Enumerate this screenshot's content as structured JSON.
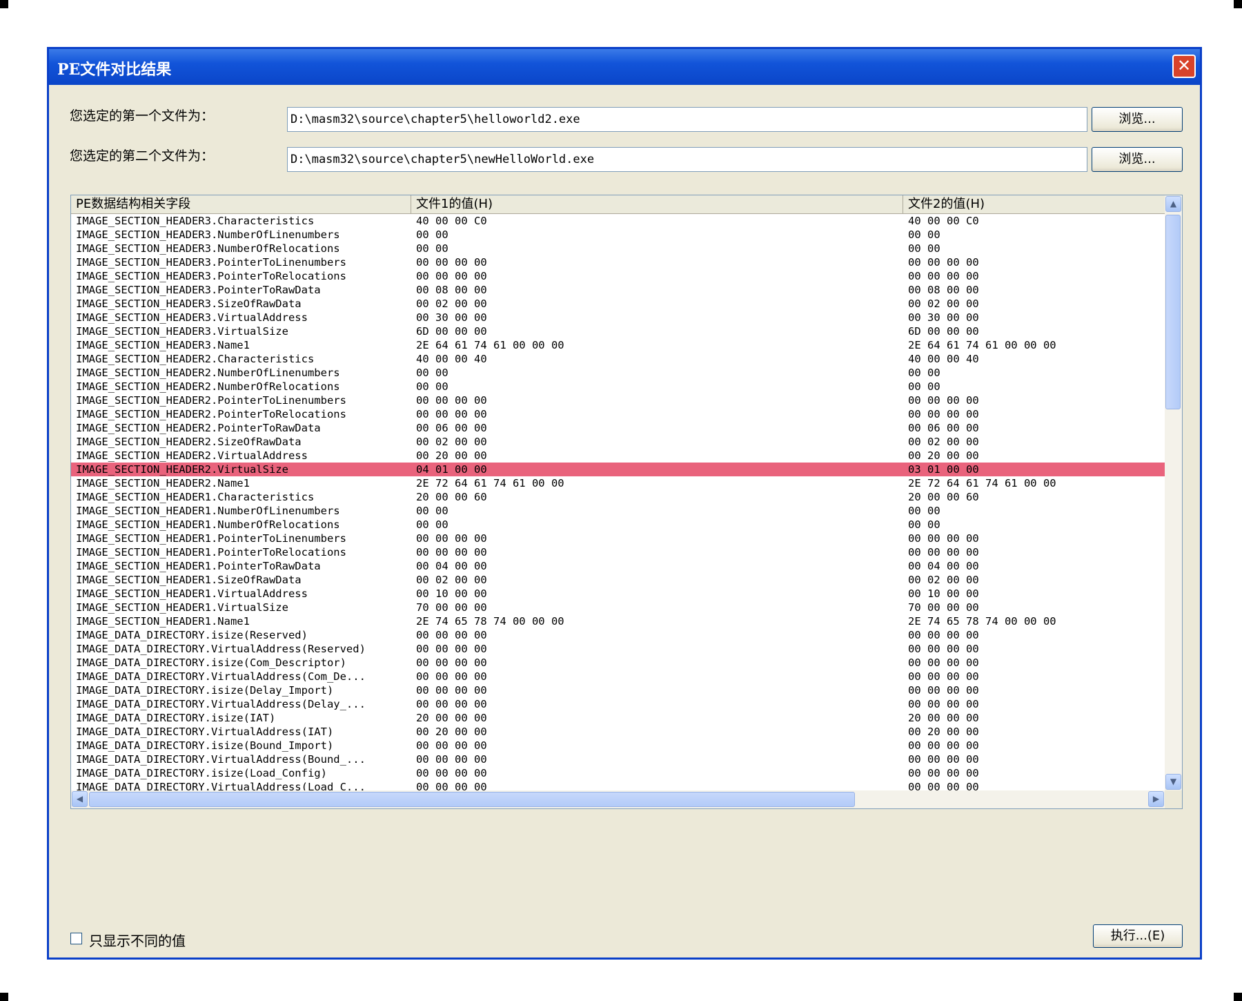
{
  "window": {
    "title": "PE文件对比结果",
    "close_label": "✕"
  },
  "file1": {
    "label": "您选定的第一个文件为：",
    "path": "D:\\masm32\\source\\chapter5\\helloworld2.exe",
    "browse_label": "浏览..."
  },
  "file2": {
    "label": "您选定的第二个文件为：",
    "path": "D:\\masm32\\source\\chapter5\\newHelloWorld.exe",
    "browse_label": "浏览..."
  },
  "table": {
    "columns": [
      "PE数据结构相关字段",
      "文件1的值(H)",
      "文件2的值(H)"
    ],
    "highlight_color": "#e9637c",
    "rows": [
      {
        "field": "IMAGE_SECTION_HEADER3.Characteristics",
        "v1": "40 00 00 C0",
        "v2": "40 00 00 C0"
      },
      {
        "field": "IMAGE_SECTION_HEADER3.NumberOfLinenumbers",
        "v1": "00 00",
        "v2": "00 00"
      },
      {
        "field": "IMAGE_SECTION_HEADER3.NumberOfRelocations",
        "v1": "00 00",
        "v2": "00 00"
      },
      {
        "field": "IMAGE_SECTION_HEADER3.PointerToLinenumbers",
        "v1": "00 00 00 00",
        "v2": "00 00 00 00"
      },
      {
        "field": "IMAGE_SECTION_HEADER3.PointerToRelocations",
        "v1": "00 00 00 00",
        "v2": "00 00 00 00"
      },
      {
        "field": "IMAGE_SECTION_HEADER3.PointerToRawData",
        "v1": "00 08 00 00",
        "v2": "00 08 00 00"
      },
      {
        "field": "IMAGE_SECTION_HEADER3.SizeOfRawData",
        "v1": "00 02 00 00",
        "v2": "00 02 00 00"
      },
      {
        "field": "IMAGE_SECTION_HEADER3.VirtualAddress",
        "v1": "00 30 00 00",
        "v2": "00 30 00 00"
      },
      {
        "field": "IMAGE_SECTION_HEADER3.VirtualSize",
        "v1": "6D 00 00 00",
        "v2": "6D 00 00 00"
      },
      {
        "field": "IMAGE_SECTION_HEADER3.Name1",
        "v1": "2E 64 61 74 61 00 00 00",
        "v2": "2E 64 61 74 61 00 00 00"
      },
      {
        "field": "IMAGE_SECTION_HEADER2.Characteristics",
        "v1": "40 00 00 40",
        "v2": "40 00 00 40"
      },
      {
        "field": "IMAGE_SECTION_HEADER2.NumberOfLinenumbers",
        "v1": "00 00",
        "v2": "00 00"
      },
      {
        "field": "IMAGE_SECTION_HEADER2.NumberOfRelocations",
        "v1": "00 00",
        "v2": "00 00"
      },
      {
        "field": "IMAGE_SECTION_HEADER2.PointerToLinenumbers",
        "v1": "00 00 00 00",
        "v2": "00 00 00 00"
      },
      {
        "field": "IMAGE_SECTION_HEADER2.PointerToRelocations",
        "v1": "00 00 00 00",
        "v2": "00 00 00 00"
      },
      {
        "field": "IMAGE_SECTION_HEADER2.PointerToRawData",
        "v1": "00 06 00 00",
        "v2": "00 06 00 00"
      },
      {
        "field": "IMAGE_SECTION_HEADER2.SizeOfRawData",
        "v1": "00 02 00 00",
        "v2": "00 02 00 00"
      },
      {
        "field": "IMAGE_SECTION_HEADER2.VirtualAddress",
        "v1": "00 20 00 00",
        "v2": "00 20 00 00"
      },
      {
        "field": "IMAGE_SECTION_HEADER2.VirtualSize",
        "v1": "04 01 00 00",
        "v2": "03 01 00 00",
        "highlight": true
      },
      {
        "field": "IMAGE_SECTION_HEADER2.Name1",
        "v1": "2E 72 64 61 74 61 00 00",
        "v2": "2E 72 64 61 74 61 00 00"
      },
      {
        "field": "IMAGE_SECTION_HEADER1.Characteristics",
        "v1": "20 00 00 60",
        "v2": "20 00 00 60"
      },
      {
        "field": "IMAGE_SECTION_HEADER1.NumberOfLinenumbers",
        "v1": "00 00",
        "v2": "00 00"
      },
      {
        "field": "IMAGE_SECTION_HEADER1.NumberOfRelocations",
        "v1": "00 00",
        "v2": "00 00"
      },
      {
        "field": "IMAGE_SECTION_HEADER1.PointerToLinenumbers",
        "v1": "00 00 00 00",
        "v2": "00 00 00 00"
      },
      {
        "field": "IMAGE_SECTION_HEADER1.PointerToRelocations",
        "v1": "00 00 00 00",
        "v2": "00 00 00 00"
      },
      {
        "field": "IMAGE_SECTION_HEADER1.PointerToRawData",
        "v1": "00 04 00 00",
        "v2": "00 04 00 00"
      },
      {
        "field": "IMAGE_SECTION_HEADER1.SizeOfRawData",
        "v1": "00 02 00 00",
        "v2": "00 02 00 00"
      },
      {
        "field": "IMAGE_SECTION_HEADER1.VirtualAddress",
        "v1": "00 10 00 00",
        "v2": "00 10 00 00"
      },
      {
        "field": "IMAGE_SECTION_HEADER1.VirtualSize",
        "v1": "70 00 00 00",
        "v2": "70 00 00 00"
      },
      {
        "field": "IMAGE_SECTION_HEADER1.Name1",
        "v1": "2E 74 65 78 74 00 00 00",
        "v2": "2E 74 65 78 74 00 00 00"
      },
      {
        "field": "IMAGE_DATA_DIRECTORY.isize(Reserved)",
        "v1": "00 00 00 00",
        "v2": "00 00 00 00"
      },
      {
        "field": "IMAGE_DATA_DIRECTORY.VirtualAddress(Reserved)",
        "v1": "00 00 00 00",
        "v2": "00 00 00 00"
      },
      {
        "field": "IMAGE_DATA_DIRECTORY.isize(Com_Descriptor)",
        "v1": "00 00 00 00",
        "v2": "00 00 00 00"
      },
      {
        "field": "IMAGE_DATA_DIRECTORY.VirtualAddress(Com_De...",
        "v1": "00 00 00 00",
        "v2": "00 00 00 00"
      },
      {
        "field": "IMAGE_DATA_DIRECTORY.isize(Delay_Import)",
        "v1": "00 00 00 00",
        "v2": "00 00 00 00"
      },
      {
        "field": "IMAGE_DATA_DIRECTORY.VirtualAddress(Delay_...",
        "v1": "00 00 00 00",
        "v2": "00 00 00 00"
      },
      {
        "field": "IMAGE_DATA_DIRECTORY.isize(IAT)",
        "v1": "20 00 00 00",
        "v2": "20 00 00 00"
      },
      {
        "field": "IMAGE_DATA_DIRECTORY.VirtualAddress(IAT)",
        "v1": "00 20 00 00",
        "v2": "00 20 00 00"
      },
      {
        "field": "IMAGE_DATA_DIRECTORY.isize(Bound_Import)",
        "v1": "00 00 00 00",
        "v2": "00 00 00 00"
      },
      {
        "field": "IMAGE_DATA_DIRECTORY.VirtualAddress(Bound_...",
        "v1": "00 00 00 00",
        "v2": "00 00 00 00"
      },
      {
        "field": "IMAGE_DATA_DIRECTORY.isize(Load_Config)",
        "v1": "00 00 00 00",
        "v2": "00 00 00 00"
      },
      {
        "field": "IMAGE_DATA_DIRECTORY.VirtualAddress(Load_C...",
        "v1": "00 00 00 00",
        "v2": "00 00 00 00"
      }
    ]
  },
  "options": {
    "only_diff_label": "只显示不同的值",
    "only_diff_checked": false
  },
  "execute": {
    "label": "执行...(E)"
  }
}
